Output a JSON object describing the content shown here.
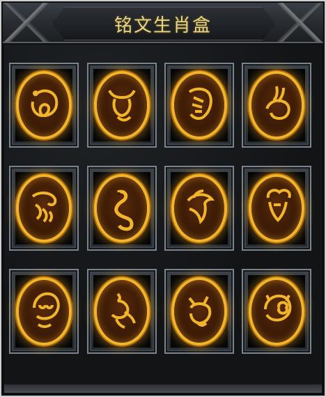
{
  "window": {
    "title": "铭文生肖盒"
  },
  "zodiac_slots": [
    {
      "animal": "rat",
      "icon": "rat-icon"
    },
    {
      "animal": "ox",
      "icon": "ox-icon"
    },
    {
      "animal": "tiger",
      "icon": "tiger-icon"
    },
    {
      "animal": "rabbit",
      "icon": "rabbit-icon"
    },
    {
      "animal": "dragon",
      "icon": "dragon-icon"
    },
    {
      "animal": "snake",
      "icon": "snake-icon"
    },
    {
      "animal": "horse",
      "icon": "horse-icon"
    },
    {
      "animal": "goat",
      "icon": "goat-icon"
    },
    {
      "animal": "monkey",
      "icon": "monkey-icon"
    },
    {
      "animal": "rooster",
      "icon": "rooster-icon"
    },
    {
      "animal": "dog",
      "icon": "dog-icon"
    },
    {
      "animal": "pig",
      "icon": "pig-icon"
    }
  ],
  "colors": {
    "medal_gold": "#f0b52a",
    "title_gold": "#e8d58b",
    "slot_frame": "#7b848c"
  }
}
